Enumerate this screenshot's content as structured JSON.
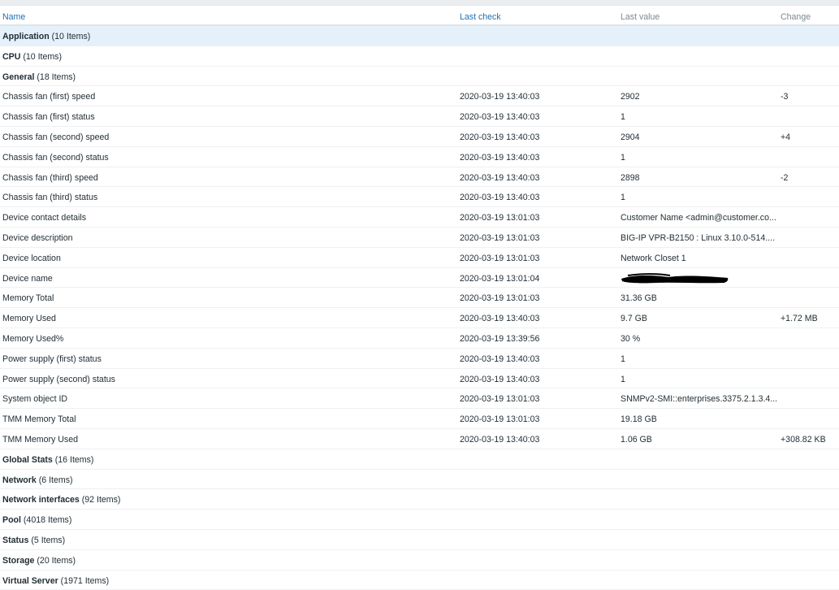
{
  "header": {
    "name": "Name",
    "last_check": "Last check",
    "last_value": "Last value",
    "change": "Change"
  },
  "groups_before": [
    {
      "name": "Application",
      "count": "(10 Items)"
    },
    {
      "name": "CPU",
      "count": "(10 Items)"
    },
    {
      "name": "General",
      "count": "(18 Items)"
    }
  ],
  "items": [
    {
      "name": "Chassis fan (first) speed",
      "last_check": "2020-03-19 13:40:03",
      "last_value": "2902",
      "change": "-3"
    },
    {
      "name": "Chassis fan (first) status",
      "last_check": "2020-03-19 13:40:03",
      "last_value": "1",
      "change": ""
    },
    {
      "name": "Chassis fan (second) speed",
      "last_check": "2020-03-19 13:40:03",
      "last_value": "2904",
      "change": "+4"
    },
    {
      "name": "Chassis fan (second) status",
      "last_check": "2020-03-19 13:40:03",
      "last_value": "1",
      "change": ""
    },
    {
      "name": "Chassis fan (third) speed",
      "last_check": "2020-03-19 13:40:03",
      "last_value": "2898",
      "change": "-2"
    },
    {
      "name": "Chassis fan (third) status",
      "last_check": "2020-03-19 13:40:03",
      "last_value": "1",
      "change": ""
    },
    {
      "name": "Device contact details",
      "last_check": "2020-03-19 13:01:03",
      "last_value": "Customer Name <admin@customer.co...",
      "change": ""
    },
    {
      "name": "Device description",
      "last_check": "2020-03-19 13:01:03",
      "last_value": "BIG-IP VPR-B2150 : Linux 3.10.0-514....",
      "change": ""
    },
    {
      "name": "Device location",
      "last_check": "2020-03-19 13:01:03",
      "last_value": "Network Closet 1",
      "change": ""
    },
    {
      "name": "Device name",
      "last_check": "2020-03-19 13:01:04",
      "last_value": "",
      "change": "",
      "redacted": true
    },
    {
      "name": "Memory Total",
      "last_check": "2020-03-19 13:01:03",
      "last_value": "31.36 GB",
      "change": ""
    },
    {
      "name": "Memory Used",
      "last_check": "2020-03-19 13:40:03",
      "last_value": "9.7 GB",
      "change": "+1.72 MB"
    },
    {
      "name": "Memory Used%",
      "last_check": "2020-03-19 13:39:56",
      "last_value": "30 %",
      "change": ""
    },
    {
      "name": "Power supply (first) status",
      "last_check": "2020-03-19 13:40:03",
      "last_value": "1",
      "change": ""
    },
    {
      "name": "Power supply (second) status",
      "last_check": "2020-03-19 13:40:03",
      "last_value": "1",
      "change": ""
    },
    {
      "name": "System object ID",
      "last_check": "2020-03-19 13:01:03",
      "last_value": "SNMPv2-SMI::enterprises.3375.2.1.3.4...",
      "change": ""
    },
    {
      "name": "TMM Memory Total",
      "last_check": "2020-03-19 13:01:03",
      "last_value": "19.18 GB",
      "change": ""
    },
    {
      "name": "TMM Memory Used",
      "last_check": "2020-03-19 13:40:03",
      "last_value": "1.06 GB",
      "change": "+308.82 KB"
    }
  ],
  "groups_after": [
    {
      "name": "Global Stats",
      "count": "(16 Items)"
    },
    {
      "name": "Network",
      "count": "(6 Items)"
    },
    {
      "name": "Network interfaces",
      "count": "(92 Items)"
    },
    {
      "name": "Pool",
      "count": "(4018 Items)"
    },
    {
      "name": "Status",
      "count": "(5 Items)"
    },
    {
      "name": "Storage",
      "count": "(20 Items)"
    },
    {
      "name": "Virtual Server",
      "count": "(1971 Items)"
    }
  ],
  "colors": {
    "header_link": "#1f70b3",
    "header_muted": "#7c8991",
    "highlight_row": "#e5f1fa",
    "text": "#1f2c33"
  }
}
